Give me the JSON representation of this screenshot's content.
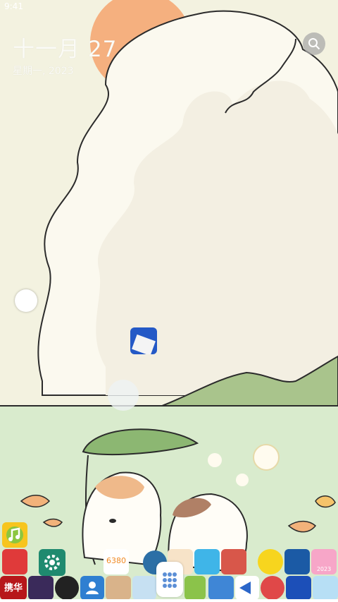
{
  "status_bar": {
    "text": "9:41"
  },
  "lockscreen": {
    "date_main": "十一月 27",
    "date_sub": "星期一, 2023"
  },
  "icons": {
    "search": "search-icon",
    "settings": "gear-icon",
    "music": "music-note-icon",
    "contacts": "contacts-icon",
    "app_drawer": "app-drawer-icon"
  },
  "app_labels": {
    "app_0": "6380",
    "app_1": "携华",
    "app_2": "2023"
  },
  "colors": {
    "sun": "#f5b07f",
    "sky": "#f6f3e4",
    "cloud": "#fbf9ef",
    "grass": "#d9ebcd",
    "hill": "#a9c48c",
    "leaf": "#8cb772",
    "settings_bg": "#1f8a6f",
    "music_bg": "#f7c51e"
  }
}
